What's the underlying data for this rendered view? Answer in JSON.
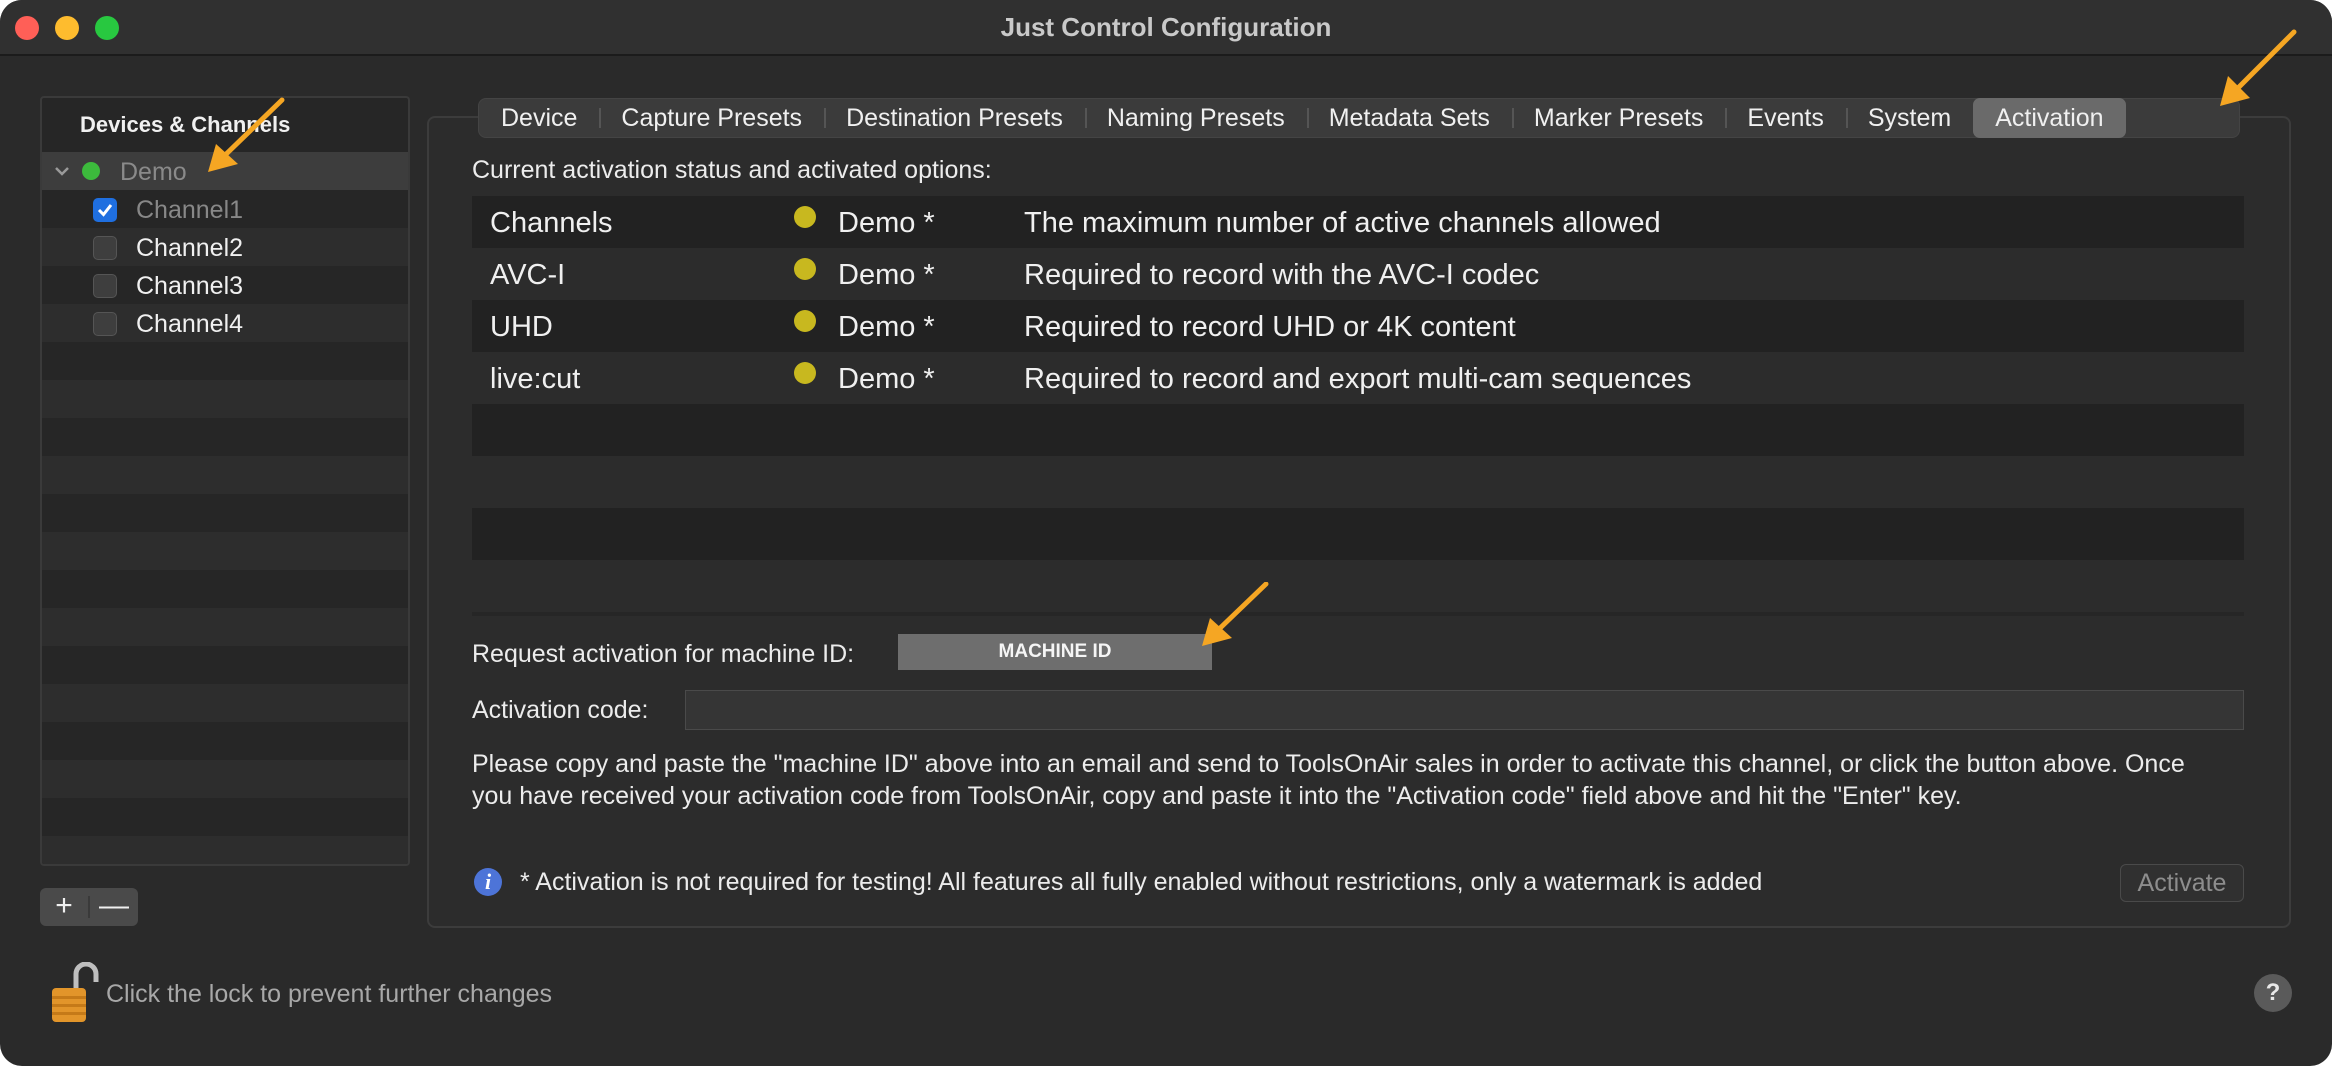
{
  "window": {
    "title": "Just Control Configuration"
  },
  "sidebar": {
    "header": "Devices & Channels",
    "device": {
      "label": "Demo",
      "status_color": "#3cba3c"
    },
    "channels": [
      {
        "label": "Channel1",
        "checked": true
      },
      {
        "label": "Channel2",
        "checked": false
      },
      {
        "label": "Channel3",
        "checked": false
      },
      {
        "label": "Channel4",
        "checked": false
      }
    ],
    "add_label": "+",
    "remove_label": "—"
  },
  "tabs": [
    {
      "label": "Device"
    },
    {
      "label": "Capture Presets"
    },
    {
      "label": "Destination Presets"
    },
    {
      "label": "Naming Presets"
    },
    {
      "label": "Metadata Sets"
    },
    {
      "label": "Marker Presets"
    },
    {
      "label": "Events"
    },
    {
      "label": "System"
    },
    {
      "label": "Activation",
      "active": true
    }
  ],
  "activation": {
    "status_heading": "Current activation status and activated options:",
    "rows": [
      {
        "option": "Channels",
        "status": "Demo *",
        "description": "The maximum number of active channels allowed"
      },
      {
        "option": "AVC-I",
        "status": "Demo *",
        "description": "Required to record with the AVC-I codec"
      },
      {
        "option": "UHD",
        "status": "Demo *",
        "description": "Required to record UHD or 4K content"
      },
      {
        "option": "live:cut",
        "status": "Demo *",
        "description": "Required to record and export multi-cam sequences"
      }
    ],
    "status_dot_color": "#c8b81f",
    "machine_id_label": "Request activation for machine ID:",
    "machine_id_value": "MACHINE ID",
    "code_label": "Activation code:",
    "code_value": "",
    "instructions": "Please copy and paste the \"machine ID\" above into an email and send to ToolsOnAir sales in order to activate this channel, or click the button above. Once you have received your activation code from ToolsOnAir, copy and paste it into the \"Activation code\" field above and hit the \"Enter\" key.",
    "note": "* Activation is not required for testing! All features all fully enabled without restrictions, only a watermark is added",
    "activate_label": "Activate"
  },
  "footer": {
    "lock_text": "Click the lock to prevent further changes",
    "help_label": "?"
  },
  "colors": {
    "annotation_arrow": "#f5a623",
    "accent": "#1f6fe0"
  }
}
